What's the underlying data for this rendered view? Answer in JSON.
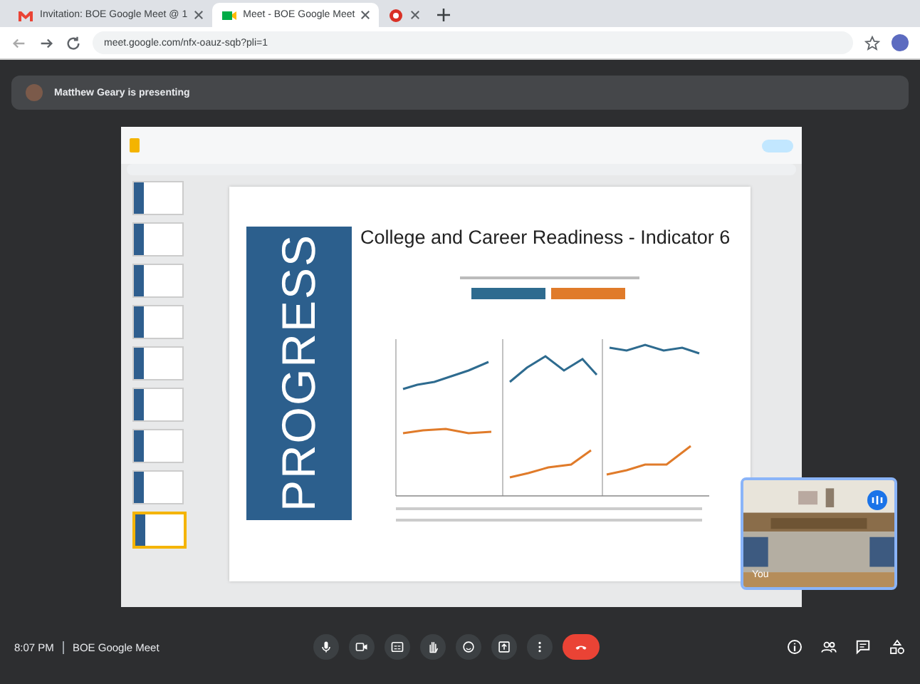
{
  "browser": {
    "tabs": [
      {
        "title": "Invitation: BOE Google Meet @ 1",
        "selected": false,
        "kind": "mail"
      },
      {
        "title": "Meet - BOE Google Meet",
        "selected": true,
        "kind": "meet"
      },
      {
        "selected": false,
        "kind": "record"
      }
    ],
    "address": "meet.google.com/nfx-oauz-sqb?pli=1"
  },
  "presenting": {
    "text": "Matthew Geary is presenting"
  },
  "slides_editor": {
    "thumbnails": [
      {
        "selected": false
      },
      {
        "selected": false
      },
      {
        "selected": false
      },
      {
        "selected": false
      },
      {
        "selected": false
      },
      {
        "selected": false
      },
      {
        "selected": false
      },
      {
        "selected": false
      },
      {
        "selected": true
      }
    ],
    "slide": {
      "vertical_text": "PROGRESS",
      "title": "College and Career Readiness - Indicator 6"
    }
  },
  "self_view": {
    "label": "You"
  },
  "meeting": {
    "time": "8:07 PM",
    "name": "BOE Google Meet"
  },
  "controls": [
    {
      "kind": "mic"
    },
    {
      "kind": "camera"
    },
    {
      "kind": "captions"
    },
    {
      "kind": "hand"
    },
    {
      "kind": "emoji"
    },
    {
      "kind": "present"
    },
    {
      "kind": "more"
    },
    {
      "kind": "end"
    }
  ],
  "side_controls": [
    {
      "kind": "info"
    },
    {
      "kind": "people"
    },
    {
      "kind": "chat"
    },
    {
      "kind": "activities"
    }
  ]
}
